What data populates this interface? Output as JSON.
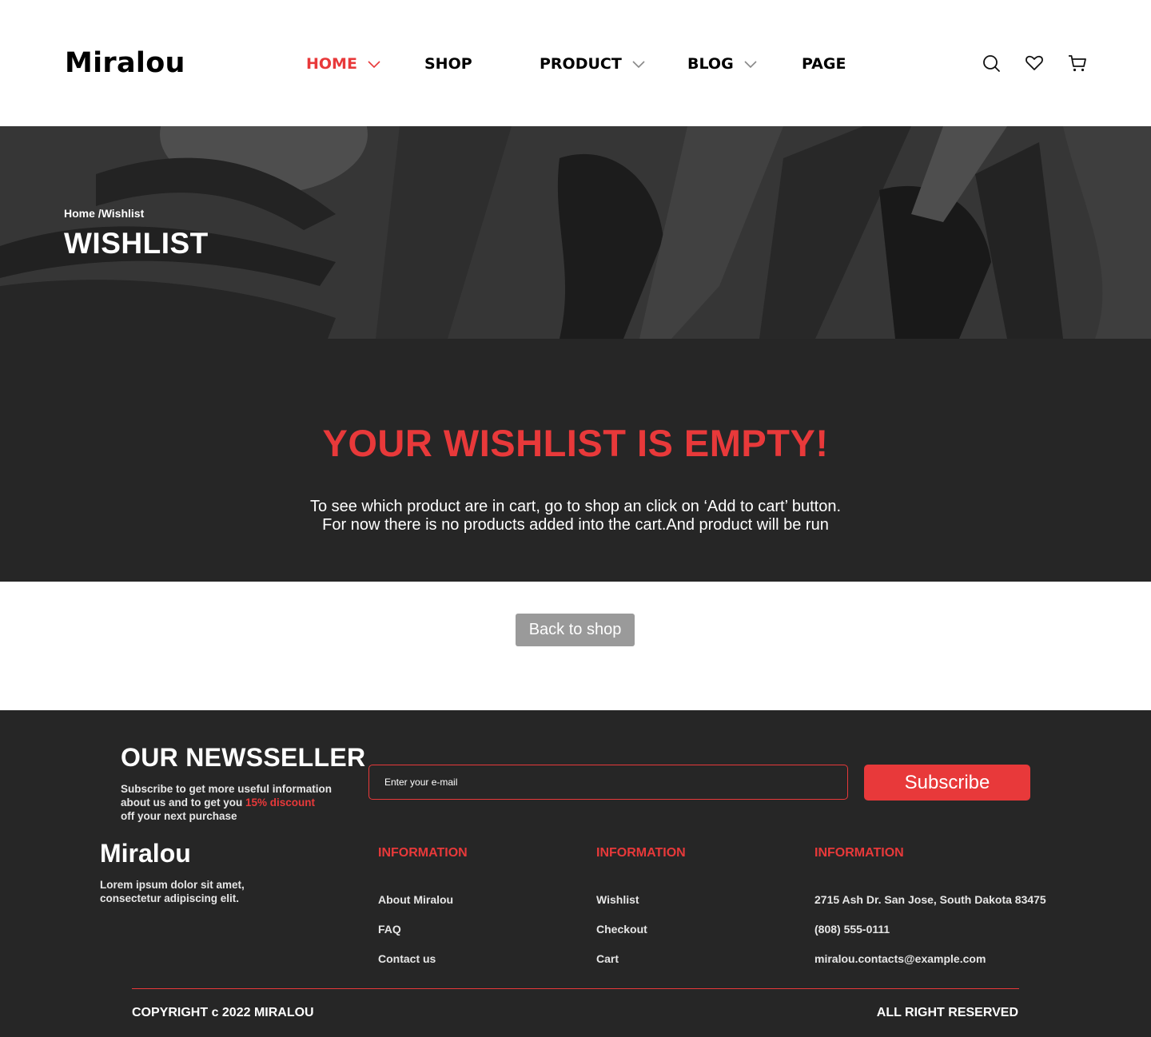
{
  "header": {
    "logo": "Miralou",
    "nav": [
      {
        "label": "HOME",
        "active": true,
        "has_dropdown": true
      },
      {
        "label": "SHOP",
        "active": false,
        "has_dropdown": false
      },
      {
        "label": "PRODUCT",
        "active": false,
        "has_dropdown": true
      },
      {
        "label": "BLOG",
        "active": false,
        "has_dropdown": true
      },
      {
        "label": "PAGE",
        "active": false,
        "has_dropdown": false
      }
    ],
    "icons": [
      "search-icon",
      "heart-icon",
      "cart-icon"
    ]
  },
  "hero": {
    "breadcrumb_home": "Home",
    "breadcrumb_sep": " /",
    "breadcrumb_current": "Wishlist",
    "title": "WISHLIST"
  },
  "empty": {
    "heading": "YOUR WISHLIST IS EMPTY!",
    "line1": "To see which product are in cart, go to shop an click on ‘Add to cart’ button.",
    "line2": "For now there is no products added into the cart.And product will be run"
  },
  "back_button": "Back to shop",
  "footer": {
    "newsletter_title": "OUR NEWSSELLER",
    "newsletter_desc_1": "Subscribe to get more useful information about us and to get you ",
    "newsletter_discount": "15% discount",
    "newsletter_desc_2": "off your next purchase",
    "email_placeholder": "Enter your e-mail",
    "subscribe_label": "Subscribe",
    "logo": "Miralou",
    "brand_desc": "Lorem ipsum dolor sit amet, consectetur adipiscing elit.",
    "columns": [
      {
        "title": "INFORMATION",
        "items": [
          "About Miralou",
          "FAQ",
          "Contact us"
        ]
      },
      {
        "title": "INFORMATION",
        "items": [
          "Wishlist",
          "Checkout",
          "Cart"
        ]
      },
      {
        "title": "INFORMATION",
        "items": [
          "2715 Ash Dr. San Jose, South Dakota 83475",
          "(808) 555-0111",
          "miralou.contacts@example.com"
        ]
      }
    ],
    "copyright": "COPYRIGHT c 2022 MIRALOU",
    "rights": "ALL RIGHT RESERVED"
  },
  "colors": {
    "accent": "#e8393a",
    "dark": "#262626",
    "button_grey": "#9a9a9a"
  }
}
